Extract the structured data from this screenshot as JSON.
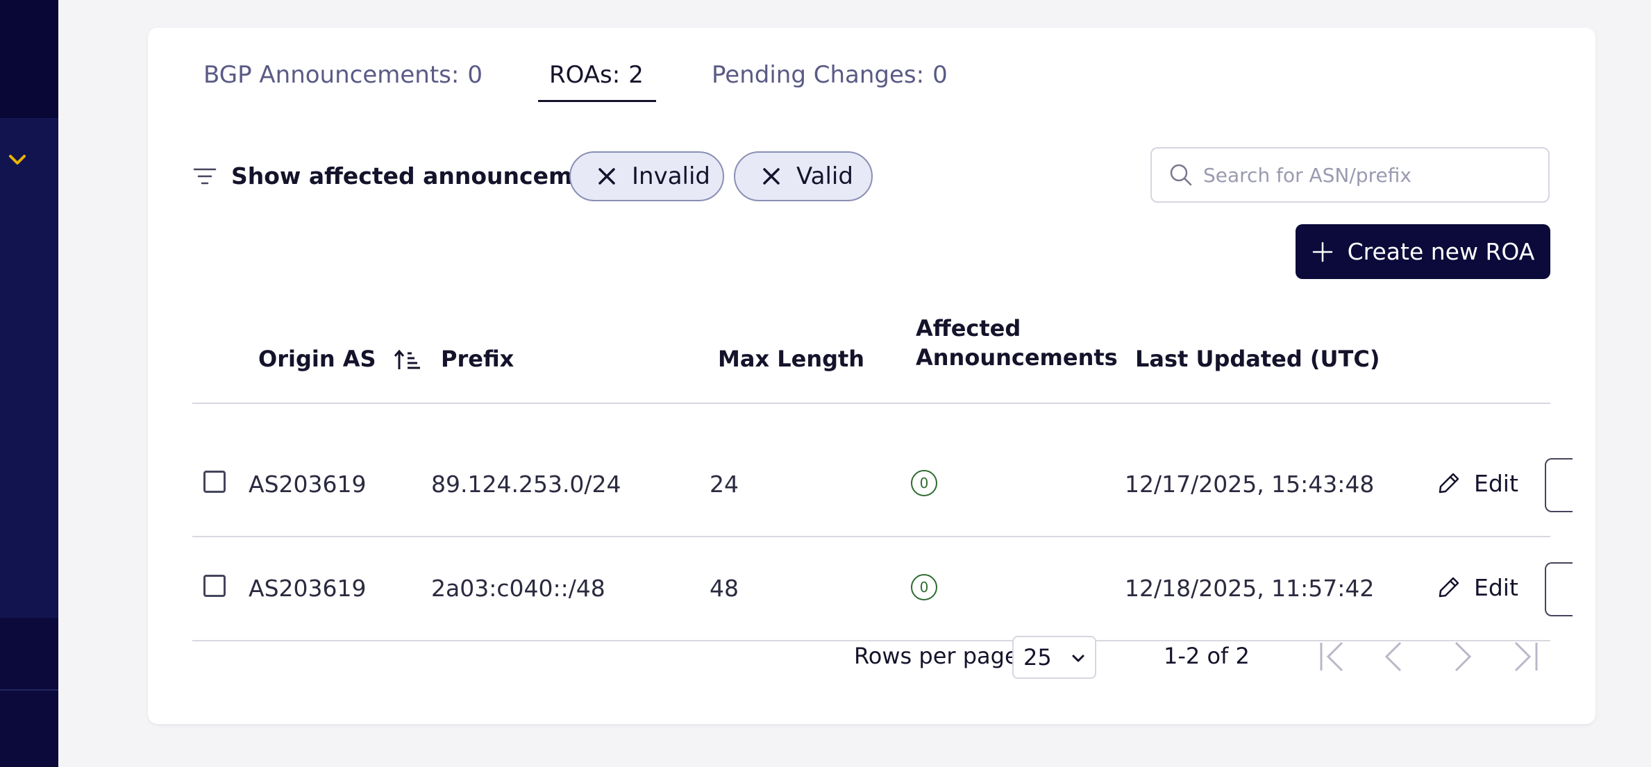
{
  "tabs": [
    {
      "label": "BGP Announcements:",
      "count": "0"
    },
    {
      "label": "ROAs:",
      "count": "2"
    },
    {
      "label": "Pending Changes:",
      "count": "0"
    }
  ],
  "filter": {
    "label": "Show affected announcements:",
    "chips": [
      "Invalid",
      "Valid"
    ]
  },
  "search": {
    "placeholder": "Search for ASN/prefix"
  },
  "create_button": {
    "label": "Create new ROA"
  },
  "table": {
    "columns": [
      "Origin AS",
      "Prefix",
      "Max Length",
      "Affected\nAnnouncements",
      "Last Updated (UTC)"
    ],
    "rows": [
      {
        "origin_as": "AS203619",
        "prefix": "89.124.253.0/24",
        "max_length": "24",
        "affected": "0",
        "last_updated": "12/17/2025, 15:43:48",
        "action": "Edit"
      },
      {
        "origin_as": "AS203619",
        "prefix": "2a03:c040::/48",
        "max_length": "48",
        "affected": "0",
        "last_updated": "12/18/2025, 11:57:42",
        "action": "Edit"
      }
    ]
  },
  "pagination": {
    "rows_per_page_label": "Rows per page",
    "rows_per_page_value": "25",
    "range": "1-2 of 2"
  },
  "icons": {
    "sidebar_chevron": "chevron-down-icon",
    "filter": "filter-lines-icon",
    "chip_remove": "close-icon",
    "search": "search-icon",
    "create": "plus-icon",
    "sort": "sort-ascending-icon",
    "edit": "pencil-icon",
    "first_page": "first-page-icon",
    "prev_page": "chevron-left-icon",
    "next_page": "chevron-right-icon",
    "last_page": "last-page-icon"
  },
  "colors": {
    "sidebar": "#0b0a3a",
    "accent_yellow": "#e8b400",
    "primary": "#0b0a3a",
    "chip_bg": "#e7e9f7",
    "badge_green": "#2f6b2f"
  }
}
